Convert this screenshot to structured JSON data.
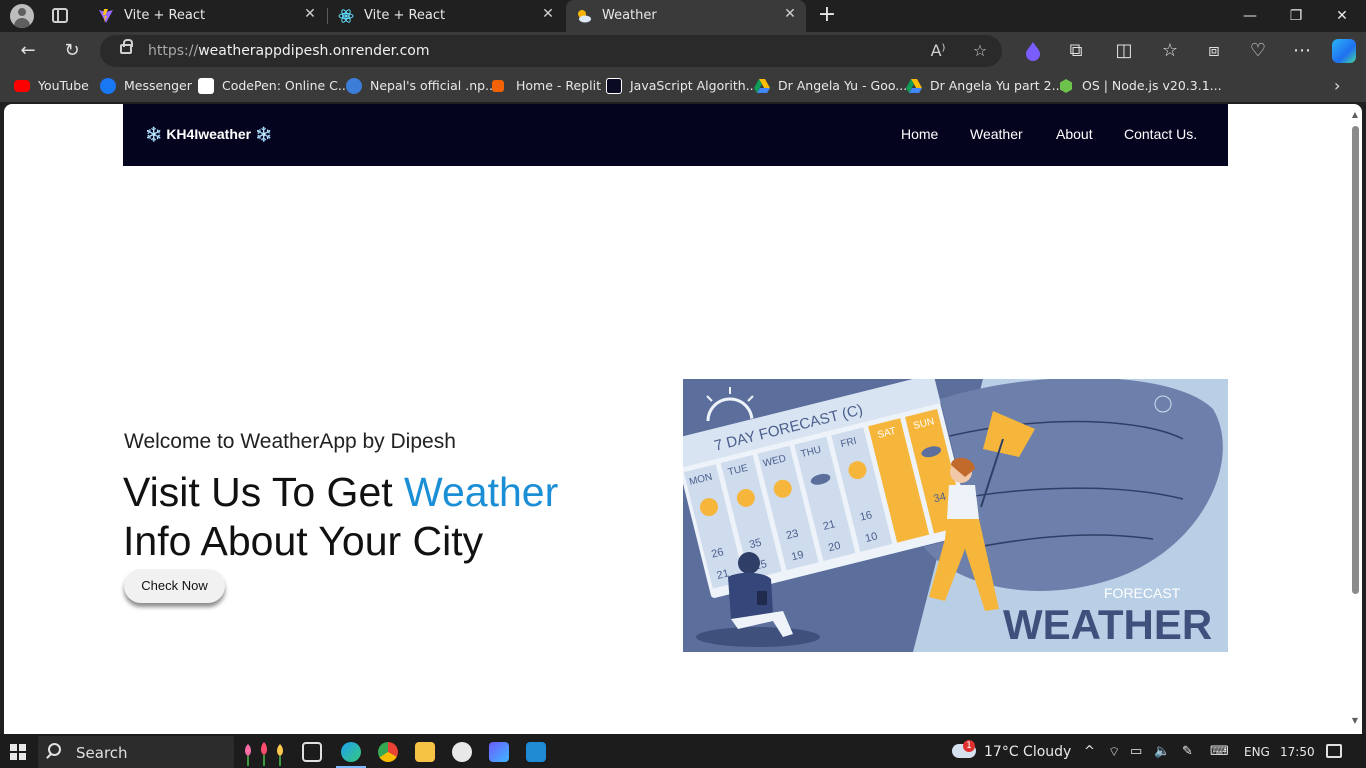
{
  "browser": {
    "tabs": [
      {
        "title": "Vite + React",
        "icon": "vite-icon"
      },
      {
        "title": "Vite + React",
        "icon": "react-icon"
      },
      {
        "title": "Weather",
        "icon": "weather-cloud-icon"
      }
    ],
    "url_scheme": "https://",
    "url_host": "weatherappdipesh.onrender.com",
    "bookmarks": [
      {
        "label": "YouTube",
        "icon": "youtube-icon",
        "color": "#ff0000"
      },
      {
        "label": "Messenger",
        "icon": "facebook-icon",
        "color": "#1877f2"
      },
      {
        "label": "CodePen: Online C...",
        "icon": "codepen-icon",
        "color": "#ffffff"
      },
      {
        "label": "Nepal's official .np...",
        "icon": "np-icon",
        "color": "#3b7dd8"
      },
      {
        "label": "Home - Replit",
        "icon": "replit-icon",
        "color": "#f26207"
      },
      {
        "label": "JavaScript Algorith...",
        "icon": "fcc-icon",
        "color": "#0a0a23"
      },
      {
        "label": "Dr Angela Yu - Goo...",
        "icon": "google-drive-icon",
        "color": "#fbbc04"
      },
      {
        "label": "Dr Angela Yu part 2...",
        "icon": "google-drive-icon",
        "color": "#fbbc04"
      },
      {
        "label": "OS | Node.js v20.3.1...",
        "icon": "nodejs-icon",
        "color": "#6cc24a"
      }
    ]
  },
  "site": {
    "brand": "❄️ KH4Iweather ❄️",
    "nav": [
      "Home",
      "Weather",
      "About",
      "Contact Us."
    ],
    "welcome": "Welcome to WeatherApp by Dipesh",
    "headline_part1": "Visit Us To Get ",
    "headline_accent": "Weather",
    "headline_part2": "Info About Your City",
    "cta": "Check Now",
    "accent_color": "#1a8fd6",
    "nav_bg": "#04041f"
  },
  "illustration": {
    "banner": "7 DAY FORECAST (C)",
    "days": [
      "MON",
      "TUE",
      "WED",
      "THU",
      "FRI",
      "SAT",
      "SUN"
    ],
    "temps": [
      "26",
      "35",
      "23",
      "21",
      "16",
      "34"
    ],
    "lows": [
      "21",
      "15",
      "19",
      "20",
      "10"
    ],
    "caption_small": "FORECAST",
    "caption_big": "WEATHER"
  },
  "taskbar": {
    "search": "Search",
    "weather": "17°C  Cloudy",
    "weather_badge": "1",
    "lang": "ENG",
    "time": "17:50"
  }
}
